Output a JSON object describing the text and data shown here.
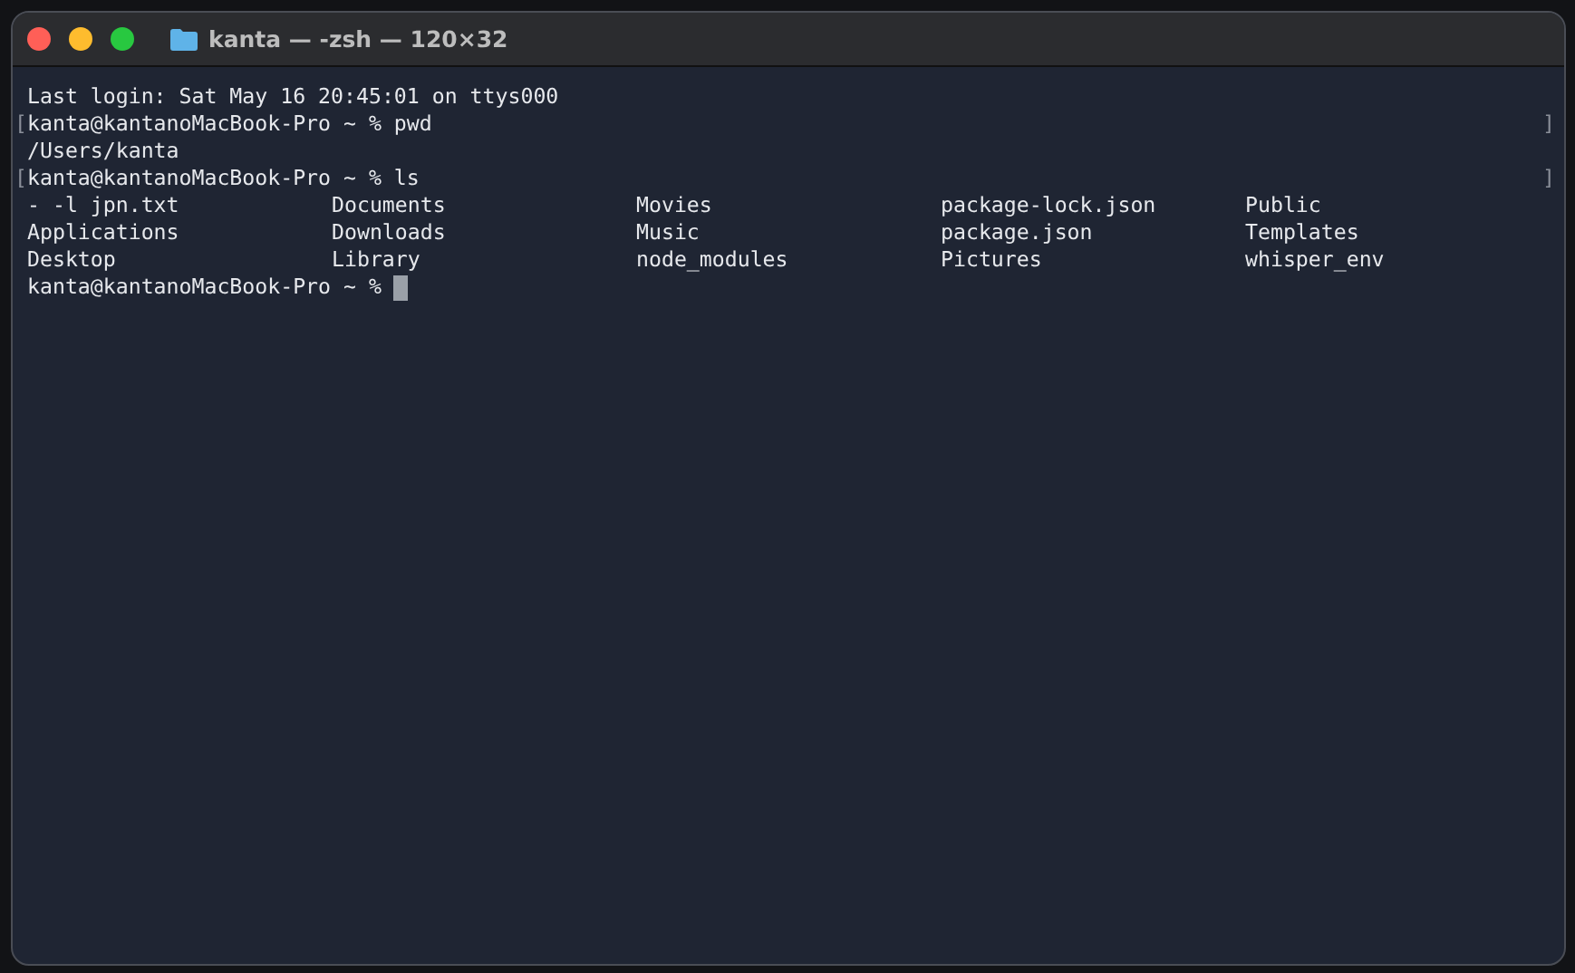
{
  "window": {
    "title": "kanta — -zsh — 120×32"
  },
  "lines": [
    {
      "kind": "text",
      "text": "Last login: Sat May 16 20:45:01 on ttys000"
    },
    {
      "kind": "prompt",
      "prompt": "kanta@kantanoMacBook-Pro ~ %",
      "command": "pwd",
      "left_mark": "[",
      "right_mark": "]"
    },
    {
      "kind": "text",
      "text": "/Users/kanta"
    },
    {
      "kind": "prompt",
      "prompt": "kanta@kantanoMacBook-Pro ~ %",
      "command": "ls",
      "left_mark": "[",
      "right_mark": "]"
    },
    {
      "kind": "listing",
      "rows": [
        [
          "- -l jpn.txt",
          "Documents",
          "Movies",
          "package-lock.json",
          "Public"
        ],
        [
          "Applications",
          "Downloads",
          "Music",
          "package.json",
          "Templates"
        ],
        [
          "Desktop",
          "Library",
          "node_modules",
          "Pictures",
          "whisper_env"
        ]
      ]
    },
    {
      "kind": "prompt",
      "prompt": "kanta@kantanoMacBook-Pro ~ %",
      "cursor": true
    }
  ]
}
